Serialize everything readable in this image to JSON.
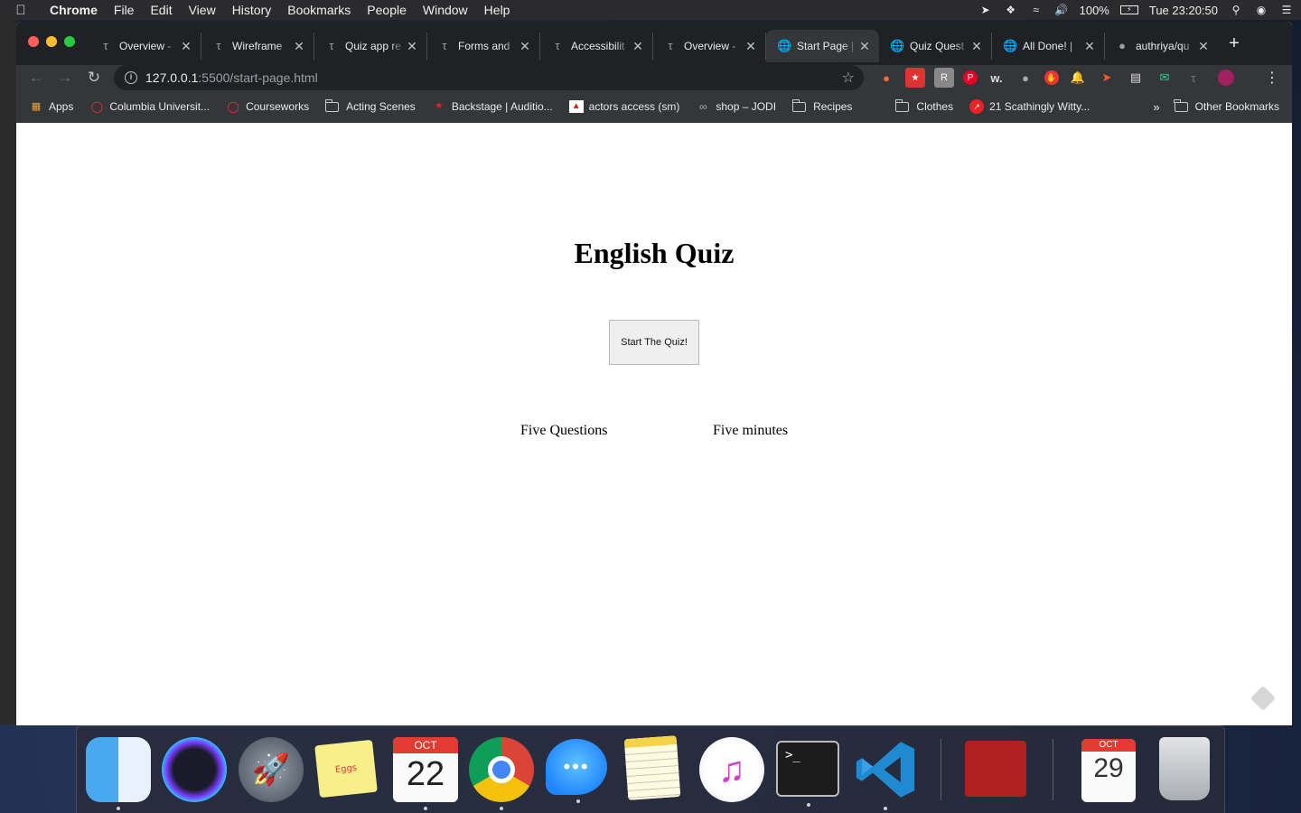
{
  "menubar": {
    "apple_icon": "apple-logo-icon",
    "items": [
      "Chrome",
      "File",
      "Edit",
      "View",
      "History",
      "Bookmarks",
      "People",
      "Window",
      "Help"
    ],
    "battery": "100%",
    "clock": "Tue 23:20:50"
  },
  "tabs": [
    {
      "title": "Overview -",
      "icon": "template-icon"
    },
    {
      "title": "Wireframe",
      "icon": "template-icon"
    },
    {
      "title": "Quiz app re",
      "icon": "template-icon"
    },
    {
      "title": "Forms and",
      "icon": "template-icon"
    },
    {
      "title": "Accessibilit",
      "icon": "template-icon"
    },
    {
      "title": "Overview -",
      "icon": "template-icon"
    },
    {
      "title": "Start Page |",
      "icon": "globe-icon",
      "active": true
    },
    {
      "title": "Quiz Quest",
      "icon": "globe-icon"
    },
    {
      "title": "All Done! |",
      "icon": "globe-icon"
    },
    {
      "title": "authriya/qu",
      "icon": "github-icon"
    }
  ],
  "address": {
    "host": "127.0.0.1",
    "path": ":5500/start-page.html"
  },
  "bookmarks": {
    "items": [
      {
        "label": "Apps",
        "icon": "apps-grid-icon"
      },
      {
        "label": "Columbia Universit...",
        "icon": "columbia-icon"
      },
      {
        "label": "Courseworks",
        "icon": "courseworks-icon"
      },
      {
        "label": "Acting Scenes",
        "icon": "folder-icon"
      },
      {
        "label": "Backstage | Auditio...",
        "icon": "star-icon"
      },
      {
        "label": "actors access (sm)",
        "icon": "actors-access-icon"
      },
      {
        "label": "shop – JODI",
        "icon": "link-icon"
      },
      {
        "label": "Recipes",
        "icon": "folder-icon"
      },
      {
        "label": "Clothes",
        "icon": "folder-icon"
      },
      {
        "label": "21 Scathingly Witty...",
        "icon": "trending-icon"
      }
    ],
    "overflow": "»",
    "other": "Other Bookmarks"
  },
  "page": {
    "title": "English Quiz",
    "start_button": "Start The Quiz!",
    "info_questions": "Five Questions",
    "info_time": "Five minutes"
  },
  "dock": {
    "apps": [
      "finder",
      "siri",
      "launchpad",
      "stickies",
      "calendar",
      "chrome",
      "messages",
      "notes",
      "itunes",
      "terminal",
      "vscode",
      "photo-booth",
      "calendar-event",
      "trash"
    ],
    "calendar_month": "OCT",
    "calendar_day": "22",
    "calendar2_month": "OCT",
    "calendar2_day": "29",
    "stickies_text": "Eggs",
    "terminal_prompt": ">_"
  }
}
